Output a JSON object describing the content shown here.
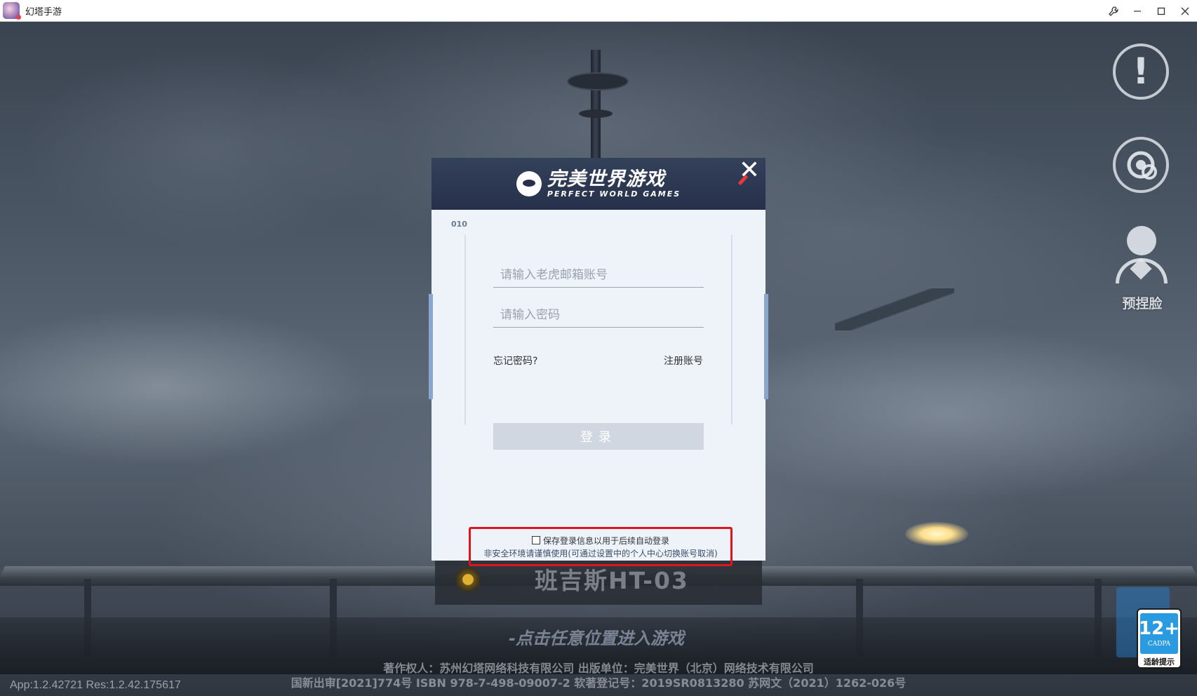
{
  "window": {
    "title": "幻塔手游",
    "controls": {
      "tool": "wrench-icon",
      "minimize": "—",
      "maximize": "☐",
      "close": "✕"
    }
  },
  "side": {
    "notice_mark": "!",
    "face_label": "预捏脸"
  },
  "character": {
    "name": "班吉斯HT-03"
  },
  "bottom": {
    "enter_hint": "-点击任意位置进入游戏",
    "copyright": "著作权人：苏州幻塔网络科技有限公司  出版单位：完美世界（北京）网络技术有限公司",
    "isbn": "国新出审[2021]774号  ISBN 978-7-498-09007-2  软著登记号：2019SR0813280  苏网文（2021）1262-026号",
    "version": "App:1.2.42721 Res:1.2.42.175617"
  },
  "rating": {
    "age": "12+",
    "org": "CADPA",
    "tip": "适龄提示"
  },
  "dialog": {
    "brand_cn": "完美世界游戏",
    "brand_en": "PERFECT WORLD GAMES",
    "tag": "010",
    "account_placeholder": "请输入老虎邮箱账号",
    "password_placeholder": "请输入密码",
    "forgot": "忘记密码?",
    "register": "注册账号",
    "login": "登录",
    "save_label": "保存登录信息以用于后续自动登录",
    "save_warning": "非安全环境请谨慎使用(可通过设置中的个人中心切换账号取消)"
  }
}
